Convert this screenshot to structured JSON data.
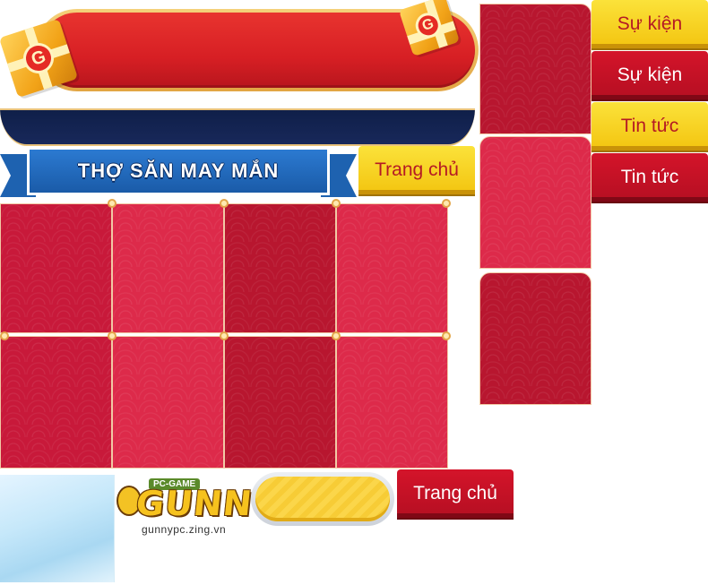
{
  "header": {
    "title": "THỢ SĂN MAY MẮN",
    "gift_badge": "G"
  },
  "buttons": {
    "home": "Trang chủ",
    "events": "Sự kiện",
    "news": "Tin tức"
  },
  "logo": {
    "pc_game": "PC-GAME",
    "word": "GUNNY",
    "url": "gunnypc.zing.vn"
  },
  "colors": {
    "red": "#d4142a",
    "yellow": "#f3c40f",
    "navy": "#0f1f49",
    "blue": "#1a5ba8"
  }
}
